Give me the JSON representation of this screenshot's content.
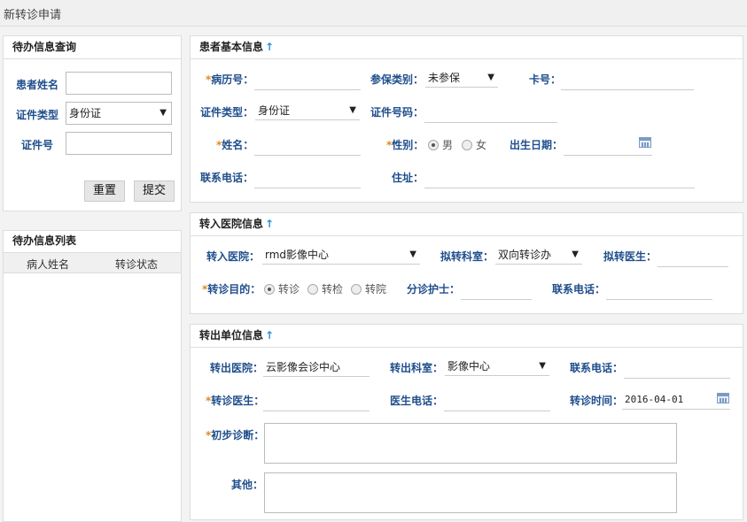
{
  "page_title": "新转诊申请",
  "left_query": {
    "title": "待办信息查询",
    "name_label": "患者姓名",
    "name_value": "",
    "idtype_label": "证件类型",
    "idtype_value": "身份证",
    "idno_label": "证件号",
    "idno_value": "",
    "reset_label": "重置",
    "submit_label": "提交"
  },
  "left_list": {
    "title": "待办信息列表",
    "columns": [
      "病人姓名",
      "转诊状态"
    ]
  },
  "patient": {
    "title": "患者基本信息",
    "arrow": "↑",
    "record_label": "病历号：",
    "record_value": "",
    "insurance_label": "参保类别：",
    "insurance_value": "未参保",
    "card_label": "卡号：",
    "card_value": "",
    "idtype_label": "证件类型：",
    "idtype_value": "身份证",
    "idno_label": "证件号码：",
    "idno_value": "",
    "name_label": "姓名：",
    "name_value": "",
    "gender_label": "性别：",
    "gender_options": [
      "男",
      "女"
    ],
    "gender_selected": "男",
    "birth_label": "出生日期：",
    "birth_value": "",
    "phone_label": "联系电话：",
    "phone_value": "",
    "address_label": "住址：",
    "address_value": ""
  },
  "in_hospital": {
    "title": "转入医院信息",
    "arrow": "↑",
    "hospital_label": "转入医院：",
    "hospital_value": "rmd影像中心",
    "dept_label": "拟转科室：",
    "dept_value": "双向转诊办",
    "doctor_label": "拟转医生：",
    "doctor_value": "",
    "purpose_label": "转诊目的：",
    "purpose_options": [
      "转诊",
      "转检",
      "转院"
    ],
    "purpose_selected": "转诊",
    "nurse_label": "分诊护士：",
    "nurse_value": "",
    "phone_label": "联系电话：",
    "phone_value": ""
  },
  "out_unit": {
    "title": "转出单位信息",
    "arrow": "↑",
    "hospital_label": "转出医院：",
    "hospital_value": "云影像会诊中心",
    "dept_label": "转出科室：",
    "dept_value": "影像中心",
    "phone_label": "联系电话：",
    "phone_value": "",
    "doctor_label": "转诊医生：",
    "doctor_value": "",
    "doctor_phone_label": "医生电话：",
    "doctor_phone_value": "",
    "time_label": "转诊时间：",
    "time_value": "2016-04-01",
    "diagnosis_label": "初步诊断：",
    "diagnosis_value": "",
    "other_label": "其他：",
    "other_value": ""
  }
}
